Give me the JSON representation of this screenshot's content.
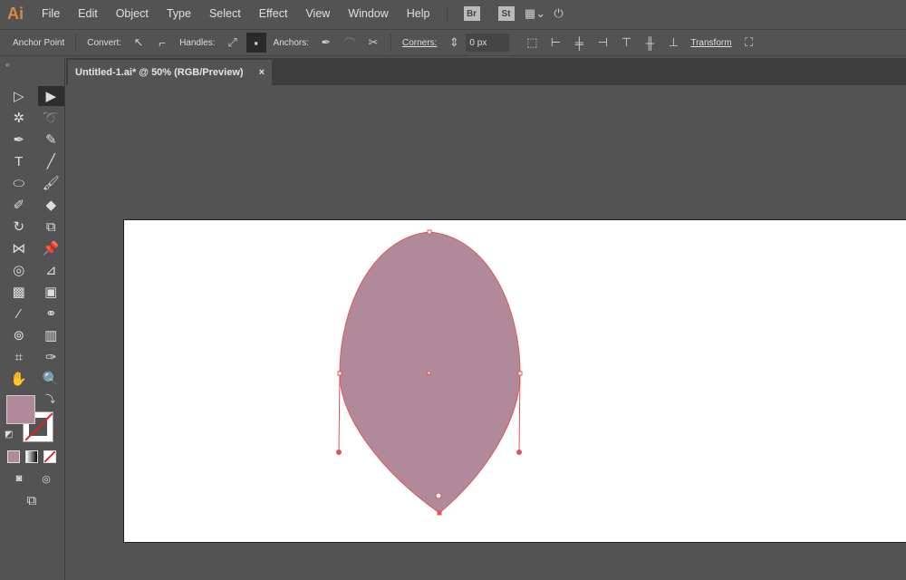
{
  "app": {
    "logo": "Ai"
  },
  "menu": [
    "File",
    "Edit",
    "Object",
    "Type",
    "Select",
    "Effect",
    "View",
    "Window",
    "Help"
  ],
  "menu_badges": [
    "Br",
    "St"
  ],
  "control": {
    "mode": "Anchor Point",
    "convert": "Convert:",
    "handles": "Handles:",
    "anchors": "Anchors:",
    "corners": "Corners:",
    "corners_value": "0 px",
    "transform": "Transform"
  },
  "tab": {
    "title": "Untitled-1.ai* @ 50% (RGB/Preview)",
    "close": "×"
  },
  "colors": {
    "fill": "#b08a9a",
    "stroke": "#e05555",
    "accent": "#d98b45"
  }
}
